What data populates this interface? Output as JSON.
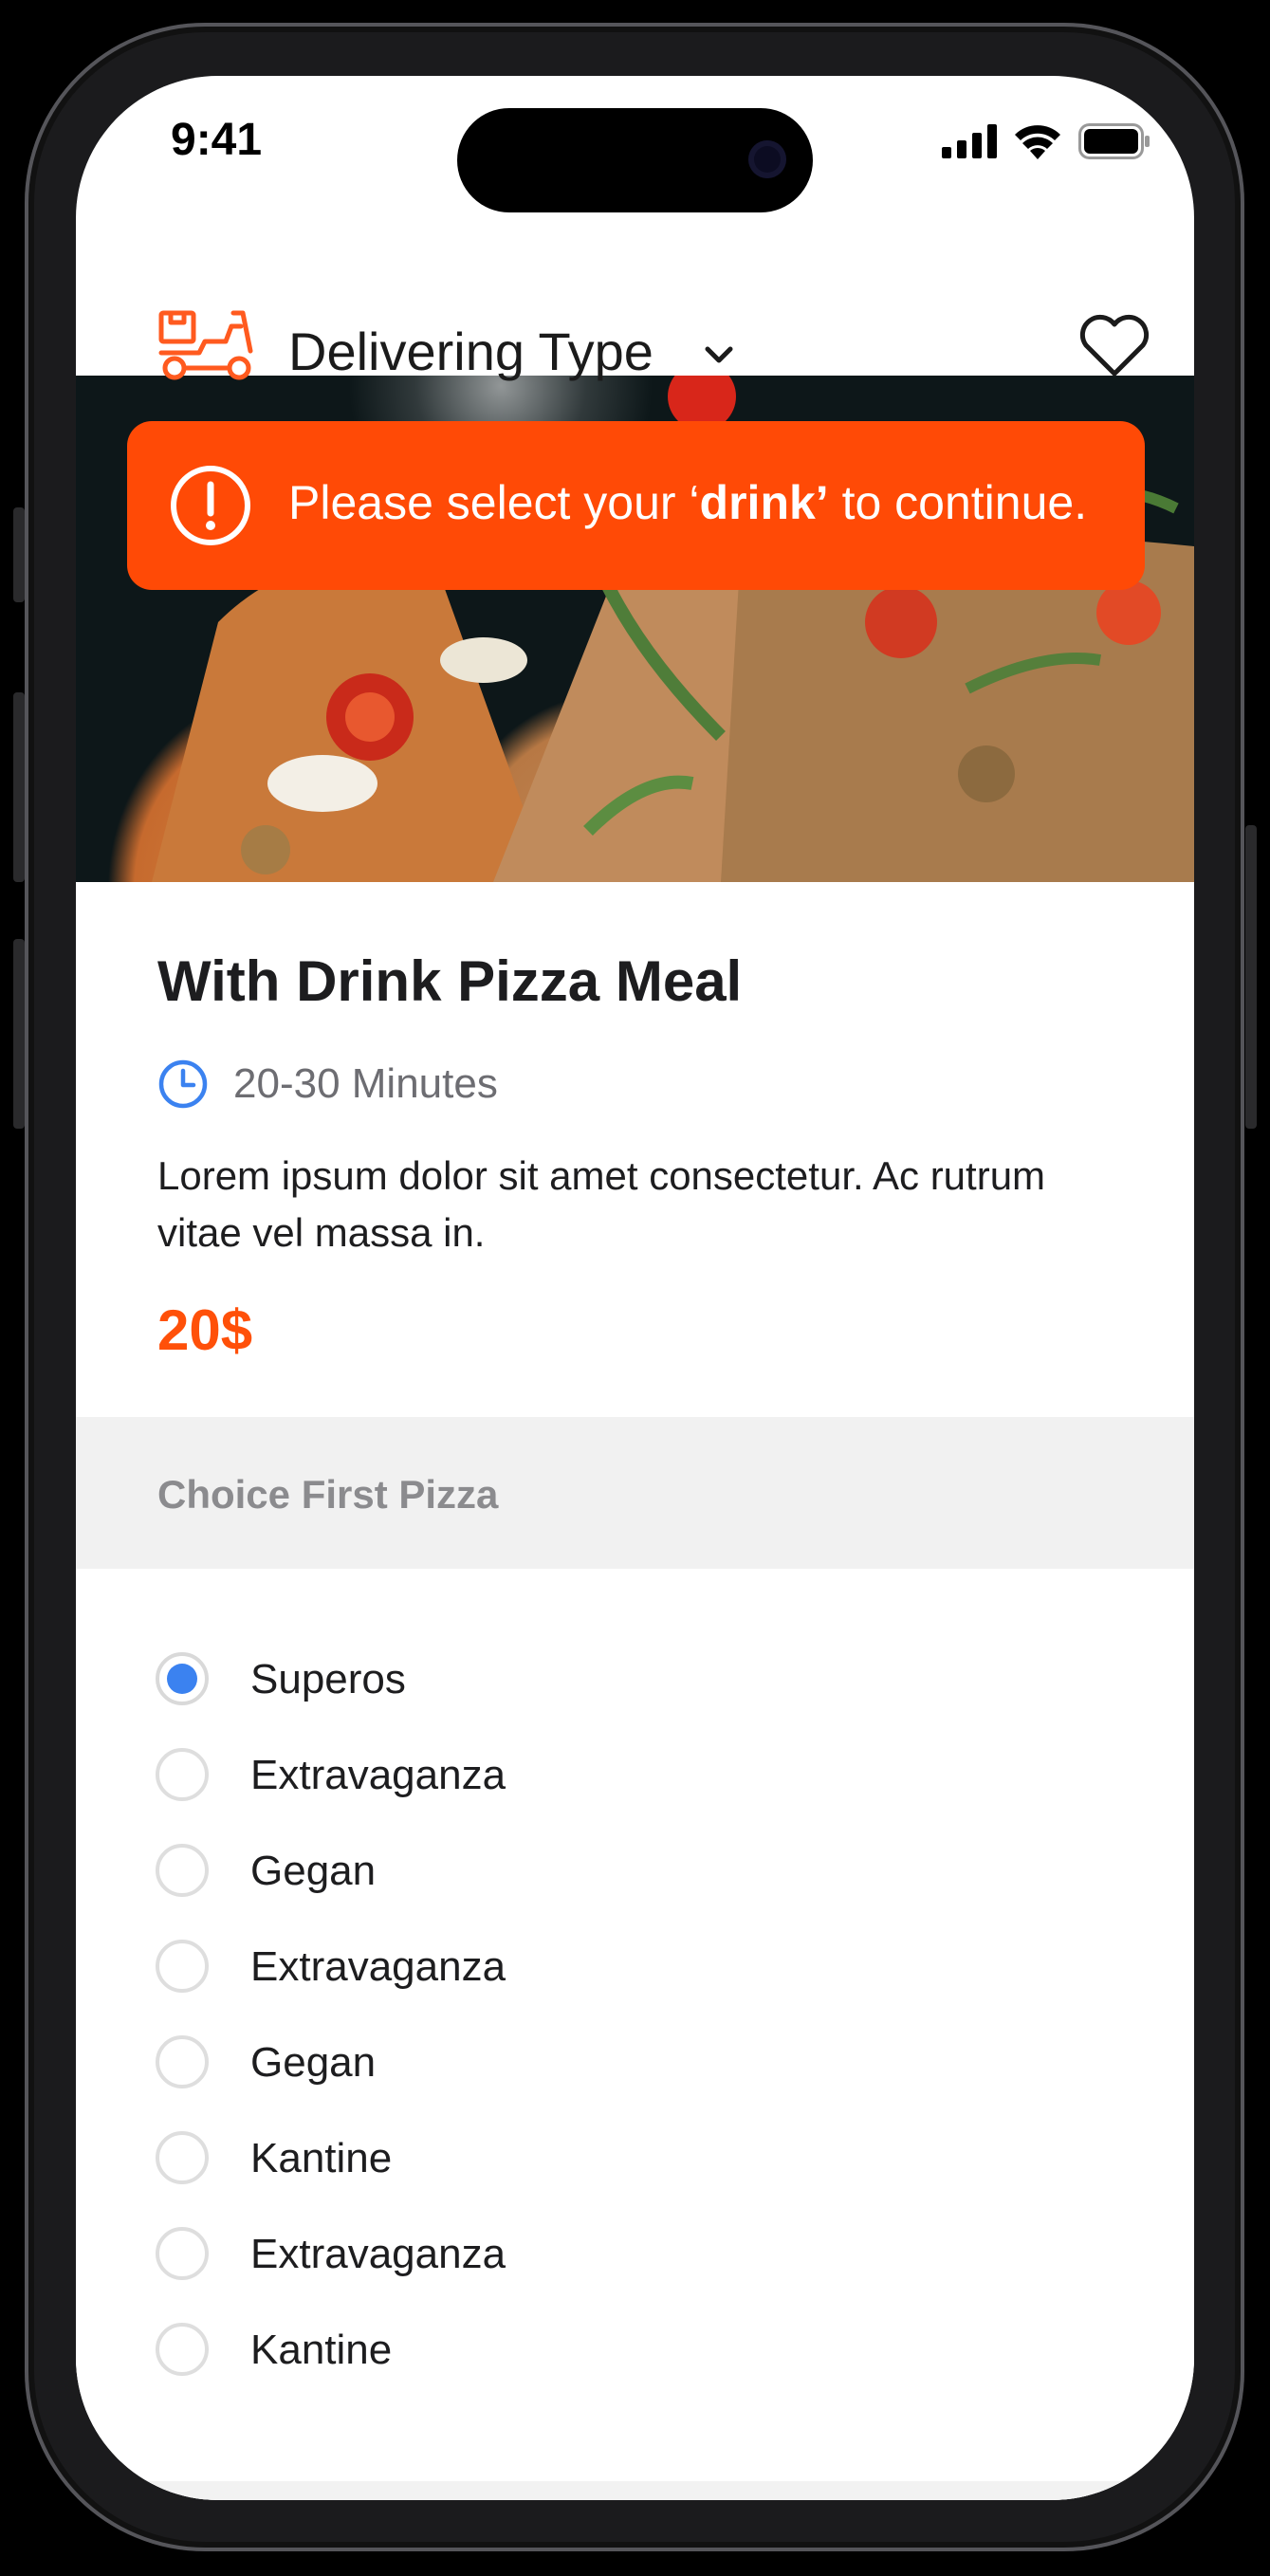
{
  "status_bar": {
    "time": "9:41"
  },
  "header": {
    "title": "Delivering Type"
  },
  "alert": {
    "prefix": "Please select your ‘",
    "highlight": "drink’",
    "suffix": " to continue."
  },
  "meal": {
    "title": "With Drink Pizza Meal",
    "prep_time": "20-30 Minutes",
    "description": "Lorem ipsum dolor sit amet consectetur. Ac rutrum vitae vel massa in.",
    "price": "20$"
  },
  "section": {
    "title": "Choice First Pizza",
    "options": [
      {
        "label": "Superos",
        "selected": true
      },
      {
        "label": "Extravaganza",
        "selected": false
      },
      {
        "label": "Gegan",
        "selected": false
      },
      {
        "label": "Extravaganza",
        "selected": false
      },
      {
        "label": "Gegan",
        "selected": false
      },
      {
        "label": "Kantine",
        "selected": false
      },
      {
        "label": "Extravaganza",
        "selected": false
      },
      {
        "label": "Kantine",
        "selected": false
      }
    ]
  },
  "colors": {
    "accent": "#ff4a06",
    "price": "#ff5009",
    "radio_selected": "#3b82f0",
    "clock": "#3b82f0"
  },
  "icons": [
    "delivery-scooter-icon",
    "chevron-down-icon",
    "heart-icon",
    "alert-circle-icon",
    "clock-icon",
    "signal-icon",
    "wifi-icon",
    "battery-icon"
  ]
}
